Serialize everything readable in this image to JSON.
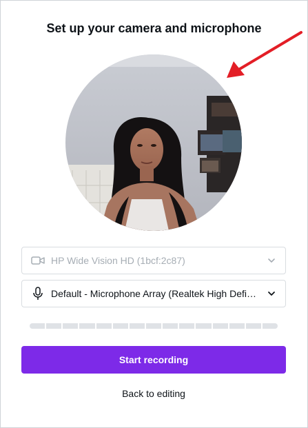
{
  "dialog": {
    "title": "Set up your camera and microphone"
  },
  "camera_select": {
    "value": "HP Wide Vision HD (1bcf:2c87)",
    "icon": "video-camera-icon",
    "disabled": true
  },
  "mic_select": {
    "value": "Default - Microphone Array (Realtek High Definition Audio)",
    "icon": "microphone-icon"
  },
  "audio_meter": {
    "level": 0
  },
  "actions": {
    "start_label": "Start recording",
    "back_label": "Back to editing"
  },
  "colors": {
    "accent": "#7d2ae8",
    "annotation_arrow": "#e31e26"
  }
}
